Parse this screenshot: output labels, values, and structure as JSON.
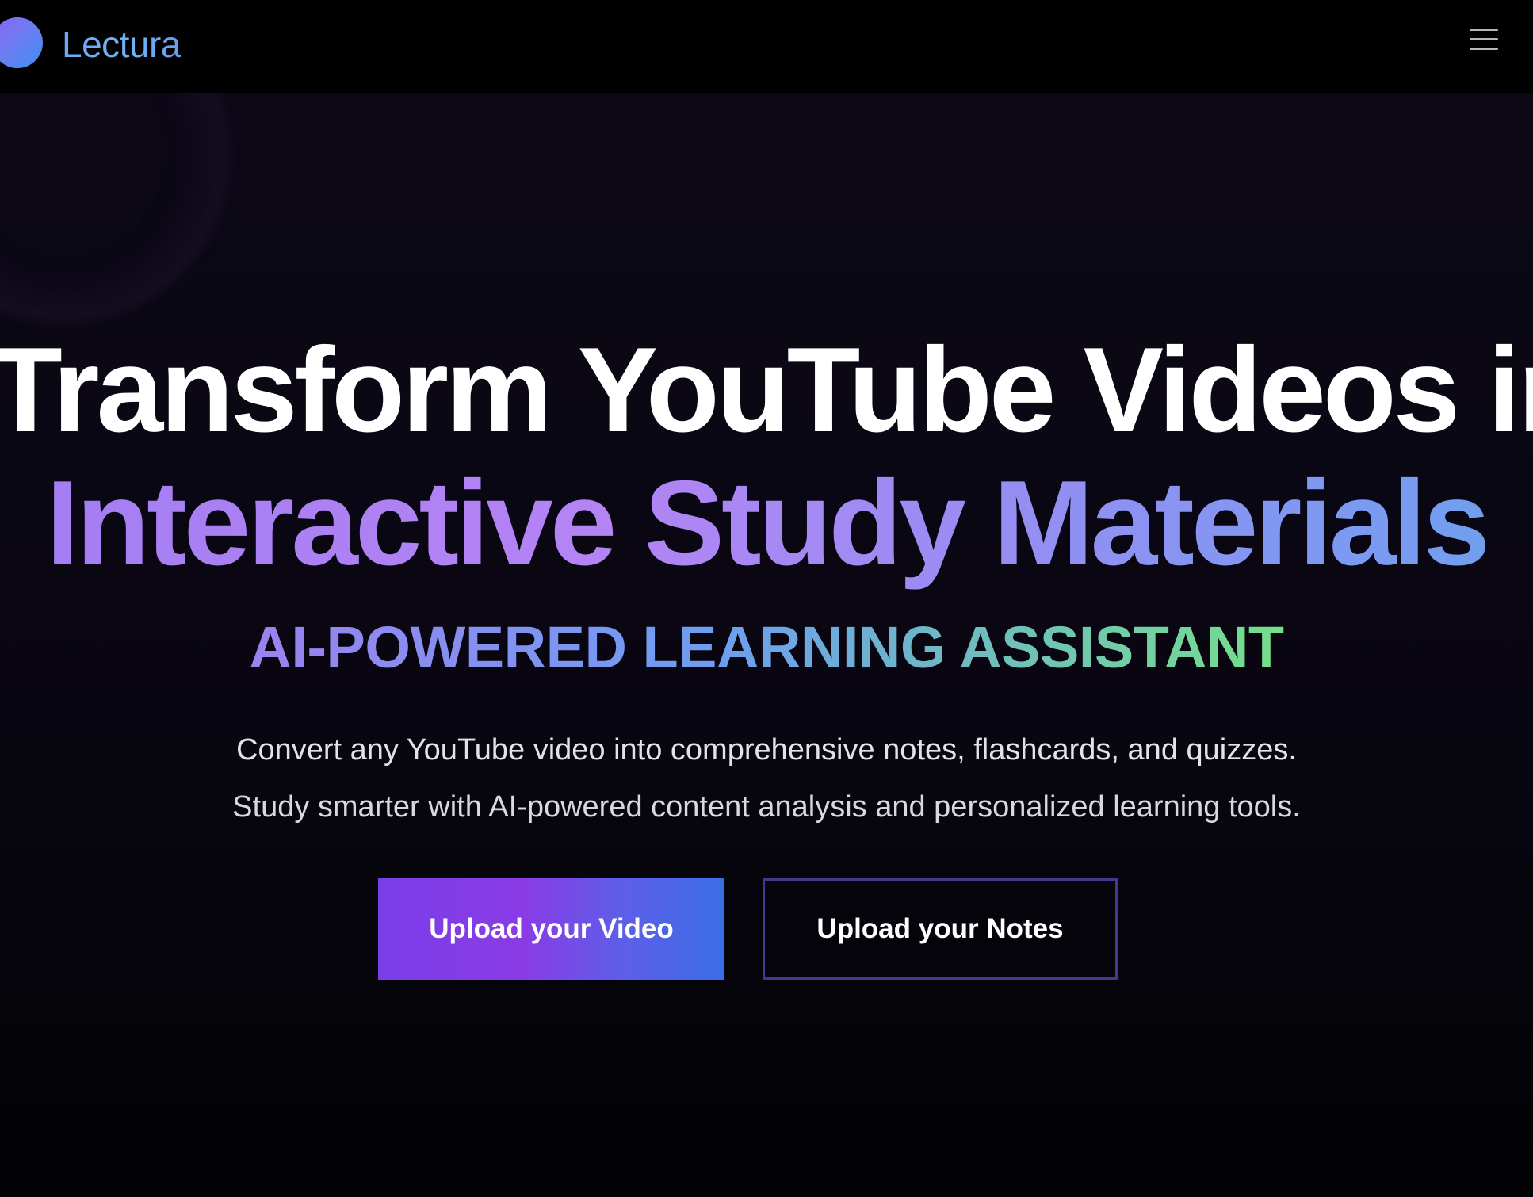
{
  "nav": {
    "brand_name": "Lectura",
    "menu_icon": "hamburger-menu-icon"
  },
  "hero": {
    "headline_line1": "Transform YouTube Videos into",
    "headline_line2": "Interactive Study Materials",
    "tagline": "AI-POWERED LEARNING ASSISTANT",
    "description_line1": "Convert any YouTube video into comprehensive notes, flashcards, and quizzes.",
    "description_line2": "Study smarter with AI-powered content analysis and personalized learning tools.",
    "primary_button": "Upload your Video",
    "secondary_button": "Upload your Notes"
  },
  "colors": {
    "background": "#0a0713",
    "accent_purple": "#8a3be6",
    "accent_blue": "#3a6ee6",
    "tagline_green": "#74e08a"
  }
}
